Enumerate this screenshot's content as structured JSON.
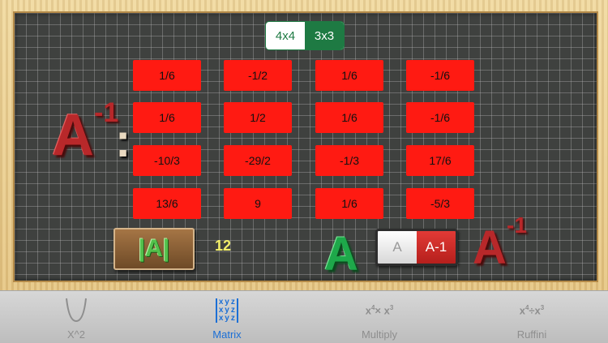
{
  "segmented": {
    "options": [
      "4x4",
      "3x3"
    ],
    "selected": "3x3"
  },
  "matrix_title": {
    "letter": "A",
    "exponent": "-1",
    "colon": ":"
  },
  "matrix": {
    "rows": [
      [
        "1/6",
        "-1/2",
        "1/6",
        "-1/6"
      ],
      [
        "1/6",
        "1/2",
        "1/6",
        "-1/6"
      ],
      [
        "-10/3",
        "-29/2",
        "-1/3",
        "17/6"
      ],
      [
        "13/6",
        "9",
        "1/6",
        "-5/3"
      ]
    ]
  },
  "determinant": {
    "button_label": "|A|",
    "value": "12"
  },
  "green_a_label": "A",
  "toggle": {
    "left": "A",
    "right": "A-1",
    "selected": "A-1"
  },
  "inverse_label": {
    "letter": "A",
    "exponent": "-1"
  },
  "tabs": [
    {
      "label": "X^2",
      "icon": "parabola-icon",
      "active": false
    },
    {
      "label": "Matrix",
      "icon": "matrix-icon",
      "active": true,
      "icon_text": [
        "x",
        "y",
        "z",
        "x",
        "y",
        "z",
        "x",
        "y",
        "z"
      ]
    },
    {
      "label": "Multiply",
      "icon": "multiply-icon",
      "active": false,
      "icon_text": "x4 x x3"
    },
    {
      "label": "Ruffini",
      "icon": "divide-icon",
      "active": false,
      "icon_text": "x4÷x3"
    }
  ],
  "colors": {
    "cell_red": "#ff1a12",
    "accent_green": "#1e7a43",
    "tab_active_blue": "#1b6fd6"
  }
}
